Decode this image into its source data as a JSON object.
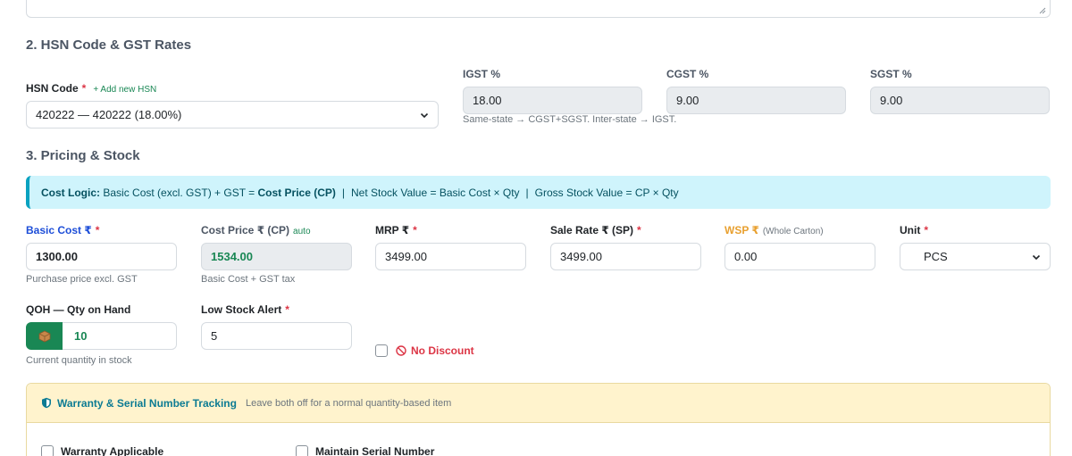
{
  "sections": {
    "hsn_title": "2. HSN Code & GST Rates",
    "pricing_title": "3. Pricing & Stock"
  },
  "hsn": {
    "label": "HSN Code",
    "required_mark": "*",
    "add_link": "+ Add new HSN",
    "selected": "420222 — 420222 (18.00%)"
  },
  "gst": {
    "igst_label": "IGST %",
    "igst_value": "18.00",
    "cgst_label": "CGST %",
    "cgst_value": "9.00",
    "sgst_label": "SGST %",
    "sgst_value": "9.00",
    "note": "Same-state → CGST+SGST. Inter-state → IGST."
  },
  "cost_logic": {
    "prefix": "Cost Logic:",
    "part1": "Basic Cost (excl. GST) + GST =",
    "part1_bold": "Cost Price (CP)",
    "divider": "|",
    "part2": "Net Stock Value = Basic Cost × Qty",
    "part3": "Gross Stock Value = CP × Qty"
  },
  "pricing": {
    "basic_cost_label": "Basic Cost ₹",
    "basic_cost_value": "1300.00",
    "basic_cost_hint": "Purchase price excl. GST",
    "cost_price_label": "Cost Price ₹ (CP)",
    "cost_price_tag": "auto",
    "cost_price_value": "1534.00",
    "cost_price_hint": "Basic Cost + GST tax",
    "mrp_label": "MRP ₹",
    "mrp_value": "3499.00",
    "sale_rate_label": "Sale Rate ₹ (SP)",
    "sale_rate_value": "3499.00",
    "wsp_label": "WSP ₹",
    "wsp_tag": "(Whole Carton)",
    "wsp_value": "0.00",
    "unit_label": "Unit",
    "unit_value": "PCS",
    "required_mark": "*"
  },
  "stock": {
    "qoh_label": "QOH — Qty on Hand",
    "qoh_value": "10",
    "qoh_hint": "Current quantity in stock",
    "low_stock_label": "Low Stock Alert",
    "low_stock_value": "5",
    "no_discount_label": "No Discount"
  },
  "warranty": {
    "title": "Warranty & Serial Number Tracking",
    "subtitle": "Leave both off for a normal quantity-based item",
    "warranty_applicable": "Warranty Applicable",
    "maintain_serial": "Maintain Serial Number"
  },
  "colors": {
    "accent_blue": "#1d4ed8",
    "success": "#198754",
    "danger": "#dc3545",
    "info_bg": "#cff4fc",
    "warning_bg": "#fff3cd"
  }
}
